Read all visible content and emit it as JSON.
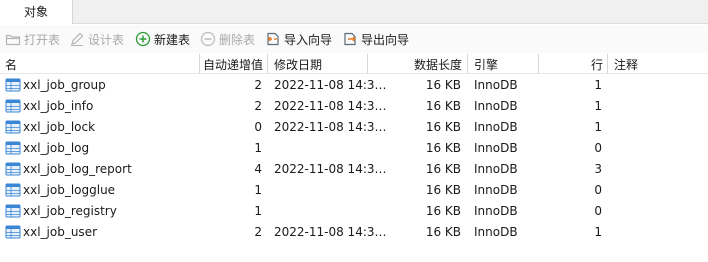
{
  "tabs": [
    {
      "label": "对象"
    }
  ],
  "toolbar": {
    "open_table": "打开表",
    "design_table": "设计表",
    "new_table": "新建表",
    "delete_table": "删除表",
    "import_wizard": "导入向导",
    "export_wizard": "导出向导"
  },
  "columns": {
    "name": "名",
    "auto_increment": "自动递增值",
    "modified": "修改日期",
    "data_length": "数据长度",
    "engine": "引擎",
    "rows": "行",
    "comment": "注释"
  },
  "tables": [
    {
      "name": "xxl_job_group",
      "auto_increment": "2",
      "modified": "2022-11-08 14:3…",
      "data_length": "16 KB",
      "engine": "InnoDB",
      "rows": "1",
      "comment": ""
    },
    {
      "name": "xxl_job_info",
      "auto_increment": "2",
      "modified": "2022-11-08 14:3…",
      "data_length": "16 KB",
      "engine": "InnoDB",
      "rows": "1",
      "comment": ""
    },
    {
      "name": "xxl_job_lock",
      "auto_increment": "0",
      "modified": "2022-11-08 14:3…",
      "data_length": "16 KB",
      "engine": "InnoDB",
      "rows": "1",
      "comment": ""
    },
    {
      "name": "xxl_job_log",
      "auto_increment": "1",
      "modified": "",
      "data_length": "16 KB",
      "engine": "InnoDB",
      "rows": "0",
      "comment": ""
    },
    {
      "name": "xxl_job_log_report",
      "auto_increment": "4",
      "modified": "2022-11-08 14:3…",
      "data_length": "16 KB",
      "engine": "InnoDB",
      "rows": "3",
      "comment": ""
    },
    {
      "name": "xxl_job_logglue",
      "auto_increment": "1",
      "modified": "",
      "data_length": "16 KB",
      "engine": "InnoDB",
      "rows": "0",
      "comment": ""
    },
    {
      "name": "xxl_job_registry",
      "auto_increment": "1",
      "modified": "",
      "data_length": "16 KB",
      "engine": "InnoDB",
      "rows": "0",
      "comment": ""
    },
    {
      "name": "xxl_job_user",
      "auto_increment": "2",
      "modified": "2022-11-08 14:3…",
      "data_length": "16 KB",
      "engine": "InnoDB",
      "rows": "1",
      "comment": ""
    }
  ],
  "icons": {
    "table": "table-icon",
    "open": "folder-icon",
    "design": "pencil-icon",
    "new": "plus-circle-icon",
    "delete": "minus-circle-icon",
    "import": "import-icon",
    "export": "export-icon"
  },
  "colors": {
    "new_icon": "#2e9b3a",
    "import_icon": "#e07b1f",
    "table_icon": "#3a86d4",
    "disabled_text": "#a9a9a9"
  }
}
